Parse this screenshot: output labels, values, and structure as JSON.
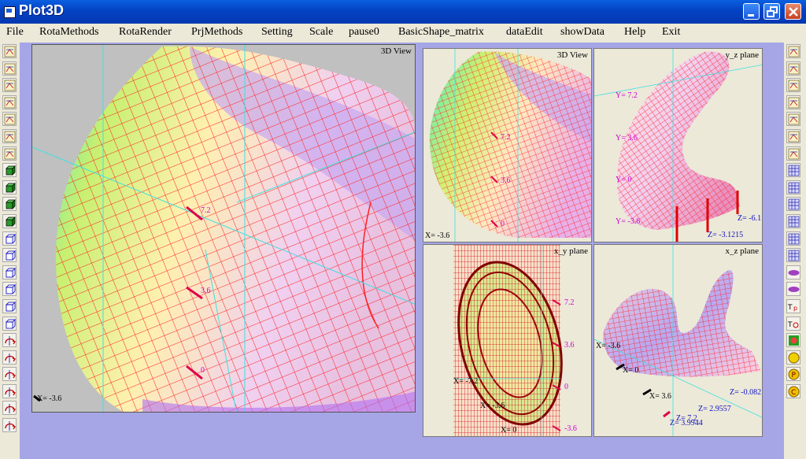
{
  "window": {
    "title": "Plot3D"
  },
  "menu": [
    "File",
    "RotaMethods",
    "RotaRender",
    "PrjMethods",
    "Setting",
    "Scale",
    "pause0",
    "BasicShape_matrix",
    "dataEdit",
    "showData",
    "Help",
    "Exit"
  ],
  "views": {
    "main": {
      "label": "3D View",
      "x_label": "X= -3.6",
      "markers": [
        "7.2",
        "3.6",
        "0"
      ]
    },
    "v3d": {
      "label": "3D View",
      "x_label": "X= -3.6",
      "markers": [
        "7.2",
        "3.6",
        "0"
      ]
    },
    "yz": {
      "label": "y_z plane",
      "y_labels": [
        "Y= 7.2",
        "Y= 3.6",
        "Y= 0",
        "Y= -3.6"
      ],
      "z_labels": [
        "Z= -3.1215",
        "Z= -6.1"
      ]
    },
    "xy": {
      "label": "x_y plane",
      "x_labels": [
        "X= -7.2",
        "X= -3.6",
        "X= 0"
      ],
      "markers": [
        "7.2",
        "3.6",
        "0",
        "-3.6"
      ]
    },
    "xz": {
      "label": "x_z plane",
      "x_labels": [
        "X= 3.6",
        "X= 0",
        "X= -3.6"
      ],
      "z_labels": [
        "Z= -0.082",
        "Z= 2.9557",
        "Z= 3.9944",
        "Z= 7.2"
      ]
    }
  },
  "colors": {
    "mesh": "#ff2020",
    "axis": "#40e0e0",
    "panel_bg": "#c0c0c0",
    "workspace": "#a6a6e6",
    "title_blue": "#0442c4"
  },
  "toolbar_left": [
    "view-icon",
    "grid-icon",
    "mesh-icon",
    "surface-icon",
    "texture-icon",
    "xy-icon",
    "xz-icon",
    "cube-icon",
    "cube-icon",
    "cube-icon",
    "cube-icon",
    "cube-outline-icon",
    "cube-outline-icon",
    "cube-outline-icon",
    "cube-outline-icon",
    "cube-outline-icon",
    "cube-outline-icon",
    "rotate-x-icon",
    "rotate-y-icon",
    "rotate-z-icon",
    "rotate-xy-icon",
    "rotate-yz-icon",
    "rotate-xz-icon"
  ],
  "toolbar_right": [
    "view-icon",
    "grid-icon",
    "mesh-icon",
    "surface-icon",
    "texture-icon",
    "xy-icon",
    "xz-icon",
    "net-icon",
    "net-icon",
    "net-icon",
    "net-icon",
    "net-icon",
    "net-icon",
    "eye-icon",
    "eye-icon",
    "tri-p-icon",
    "tri-r-icon",
    "color-icon",
    "smile-icon",
    "p-circle-icon",
    "c-circle-icon"
  ]
}
